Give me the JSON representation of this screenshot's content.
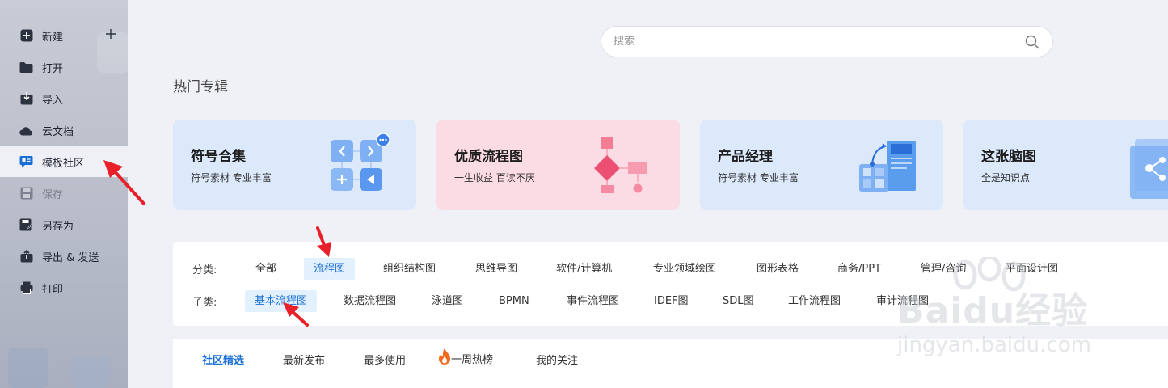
{
  "sidebar": {
    "items": [
      {
        "label": "新建",
        "icon": "plus-square-icon"
      },
      {
        "label": "打开",
        "icon": "folder-icon"
      },
      {
        "label": "导入",
        "icon": "import-icon"
      },
      {
        "label": "云文档",
        "icon": "cloud-icon"
      },
      {
        "label": "模板社区",
        "icon": "template-community-icon",
        "active": true
      },
      {
        "label": "保存",
        "icon": "save-icon",
        "disabled": true
      },
      {
        "label": "另存为",
        "icon": "save-as-icon"
      },
      {
        "label": "导出 & 发送",
        "icon": "export-icon"
      },
      {
        "label": "打印",
        "icon": "printer-icon"
      }
    ]
  },
  "search": {
    "placeholder": "搜索"
  },
  "section_title": "热门专辑",
  "cards": [
    {
      "title": "符号合集",
      "subtitle": "符号素材 专业丰富",
      "bg": "#dbe9fb"
    },
    {
      "title": "优质流程图",
      "subtitle": "一生收益 百读不厌",
      "bg": "#fcdce4"
    },
    {
      "title": "产品经理",
      "subtitle": "符号素材 专业丰富",
      "bg": "#dbe9fb"
    },
    {
      "title": "这张脑图",
      "subtitle": "全是知识点",
      "bg": "#dbe9fb"
    }
  ],
  "filter": {
    "category_label": "分类:",
    "categories": [
      "全部",
      "流程图",
      "组织结构图",
      "思维导图",
      "软件/计算机",
      "专业领域绘图",
      "图形表格",
      "商务/PPT",
      "管理/咨询",
      "平面设计图"
    ],
    "selected_category": "流程图",
    "subcategory_label": "子类:",
    "subcategories": [
      "基本流程图",
      "数据流程图",
      "泳道图",
      "BPMN",
      "事件流程图",
      "IDEF图",
      "SDL图",
      "工作流程图",
      "审计流程图"
    ],
    "selected_subcategory": "基本流程图"
  },
  "tabs": [
    "社区精选",
    "最新发布",
    "最多使用",
    "一周热榜",
    "我的关注"
  ],
  "selected_tab": "社区精选",
  "watermark": {
    "logo": "Baidu经验",
    "url": "jingyan.baidu.com"
  },
  "colors": {
    "accent": "#1a6fd6",
    "arrow": "#e8202a",
    "chip_bg": "#e3f0fd"
  }
}
